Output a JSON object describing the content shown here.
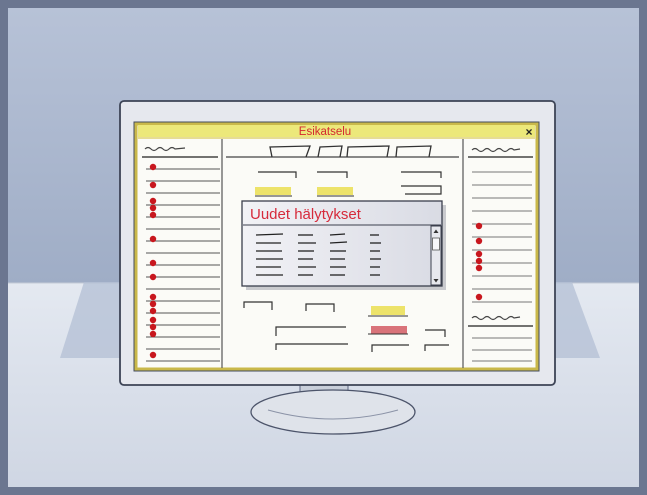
{
  "window": {
    "title": "Esikatselu",
    "close_glyph": "×"
  },
  "popup": {
    "title": "Uudet hälytykset"
  },
  "colors": {
    "wall": "#a7b4cc",
    "desk": "#dde3ee",
    "title_bar": "#ece87a",
    "title_text": "#d4282e",
    "alert_dot": "#c8171e",
    "highlight_yellow": "#ede36a",
    "highlight_red": "#d9737a",
    "popup_title_bg": "#e24a5b"
  },
  "icons": {
    "close": "close-icon",
    "scroll_up": "chevron-up-icon",
    "scroll_down": "chevron-down-icon",
    "alert": "red-dot-icon"
  }
}
